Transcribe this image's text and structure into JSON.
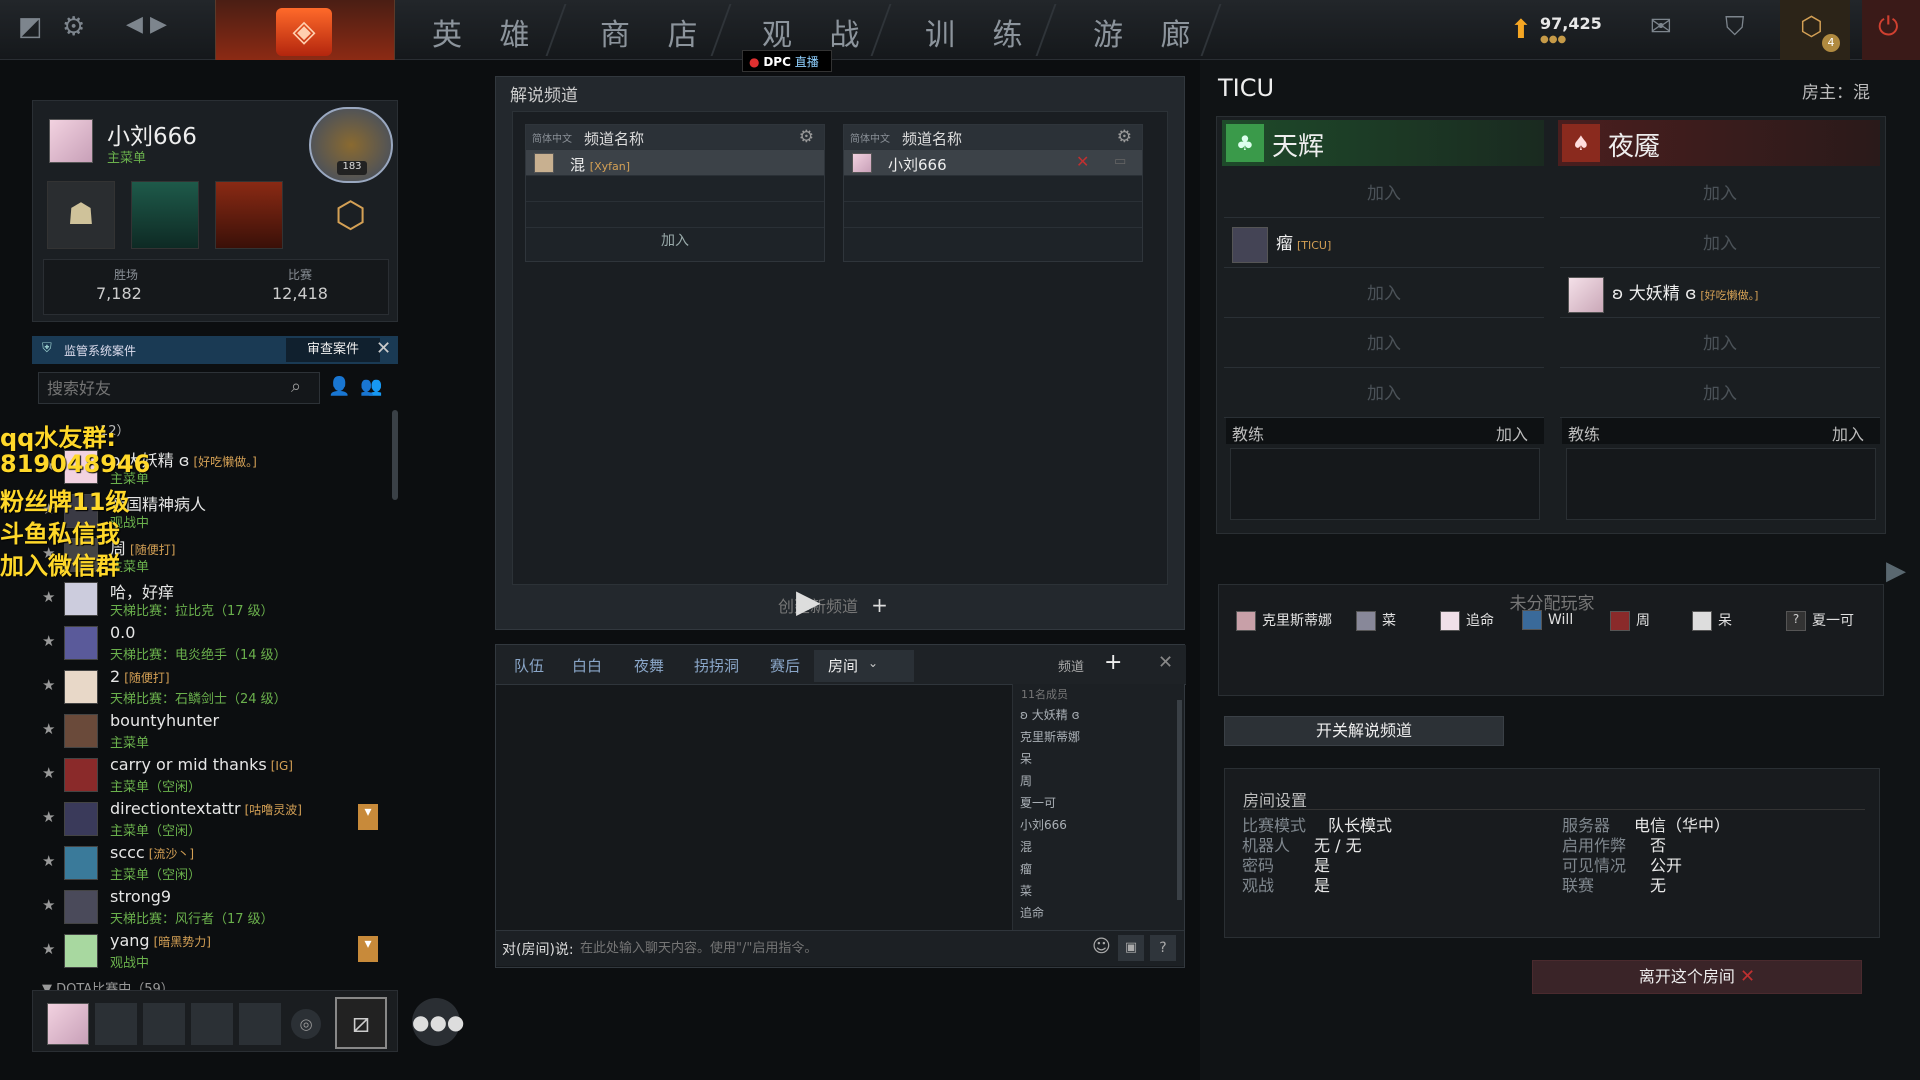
{
  "topbar": {
    "nav": [
      "英 雄",
      "商 店",
      "观 战",
      "训 练",
      "游 廊"
    ],
    "dpc_label": "DPC",
    "live_label": "直播",
    "currency": "97,425",
    "notif_count": "4"
  },
  "profile": {
    "name": "小刘666",
    "status": "主菜单",
    "rank_number": "183",
    "wins_label": "胜场",
    "wins_value": "7,182",
    "matches_label": "比赛",
    "matches_value": "12,418"
  },
  "overwatch": {
    "title": "监管系统案件",
    "review_button": "审查案件"
  },
  "search": {
    "placeholder": "搜索好友"
  },
  "overlay_lines": [
    "qq水友群:",
    "819048946",
    "粉丝牌11级",
    "斗鱼私信我",
    "加入微信群"
  ],
  "friends_header": "12）",
  "friends": [
    {
      "name": "ʚ 大妖精 ɞ",
      "tag": "[好吃懒做。]",
      "status": "主菜单"
    },
    {
      "name": "帝国精神病人",
      "tag": "",
      "status": "观战中"
    },
    {
      "name": "周",
      "tag": "[随便打]",
      "status": "主菜单"
    },
    {
      "name": "哈，好痒",
      "tag": "",
      "status": "天梯比赛：拉比克（17 级）"
    },
    {
      "name": "0.0",
      "tag": "",
      "status": "天梯比赛：电炎绝手（14 级）"
    },
    {
      "name": "2",
      "tag": "[随便打]",
      "status": "天梯比赛：石鳞剑士（24 级）"
    },
    {
      "name": "bountyhunter",
      "tag": "",
      "status": "主菜单"
    },
    {
      "name": "carry or mid thanks",
      "tag": "[IG]",
      "status": "主菜单（空闲）"
    },
    {
      "name": "directiontextattr",
      "tag": "[咕噜灵波]",
      "status": "主菜单（空闲）"
    },
    {
      "name": "sccc",
      "tag": "[流沙丶]",
      "status": "主菜单（空闲）"
    },
    {
      "name": "strong9",
      "tag": "",
      "status": "天梯比赛：风行者（17 级）"
    },
    {
      "name": "yang",
      "tag": "[暗黑势力]",
      "status": "观战中"
    }
  ],
  "friends_footer": "▼ DOTA比赛中（59）",
  "commentary": {
    "title": "解说频道",
    "lang": "简体中文",
    "channel_label": "频道名称",
    "left_member": "混",
    "left_member_tag": "[Xyfan]",
    "right_member": "小刘666",
    "join": "加入",
    "create": "创建新频道"
  },
  "chat": {
    "tabs": [
      "队伍",
      "白白",
      "夜舞",
      "拐拐洞",
      "赛后",
      "房间"
    ],
    "channel_label": "频道",
    "member_count": "11名成员",
    "members": [
      "ʚ 大妖精 ɞ",
      "克里斯蒂娜",
      "呆",
      "周",
      "夏一可",
      "小刘666",
      "混",
      "瘤",
      "菜",
      "追命"
    ],
    "input_label": "对(房间)说:",
    "input_placeholder": "在此处输入聊天内容。使用\"/\"启用指令。"
  },
  "lobby": {
    "name": "TICU",
    "host": "房主：混",
    "radiant": "天辉",
    "dire": "夜魇",
    "join": "加入",
    "radiant_player": "瘤",
    "radiant_player_tag": "[TICU]",
    "dire_player": "ʚ 大妖精 ɞ",
    "dire_player_tag": "[好吃懒做。]",
    "coach": "教练",
    "unassigned_title": "未分配玩家",
    "unassigned": [
      "克里斯蒂娜",
      "菜",
      "追命",
      "Will",
      "周",
      "呆",
      "夏一可"
    ],
    "toggle_button": "开关解说频道",
    "settings_title": "房间设置",
    "settings_left": [
      [
        "比赛模式",
        "队长模式"
      ],
      [
        "机器人",
        "无 / 无"
      ],
      [
        "密码",
        "是"
      ],
      [
        "观战",
        "是"
      ]
    ],
    "settings_right": [
      [
        "服务器",
        "电信（华中）"
      ],
      [
        "启用作弊",
        "否"
      ],
      [
        "可见情况",
        "公开"
      ],
      [
        "联赛",
        "无"
      ]
    ],
    "leave_button": "离开这个房间"
  },
  "colors": {
    "radiant": "#5cb85c",
    "dire": "#c0392b",
    "accent": "#d4a055"
  }
}
